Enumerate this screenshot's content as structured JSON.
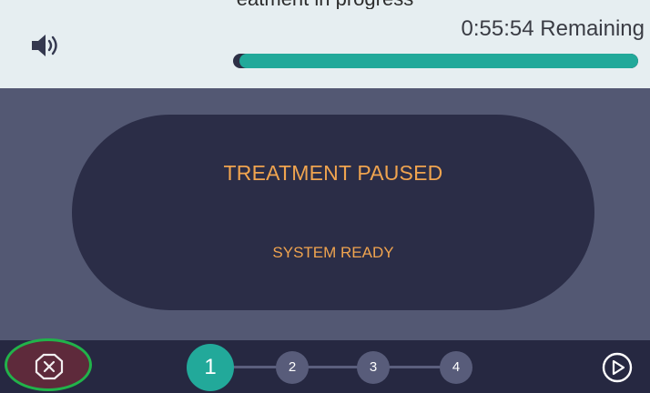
{
  "header": {
    "cut_off_title": "eatment in progress",
    "time_remaining": "0:55:54 Remaining",
    "progress_fraction": 0.985,
    "icons": {
      "volume": "speaker-volume-icon"
    }
  },
  "status": {
    "main": "TREATMENT PAUSED",
    "sub": "SYSTEM READY"
  },
  "footer": {
    "stop_icon": "stop-octagon-x-icon",
    "play_icon": "play-circle-icon",
    "steps": [
      "1",
      "2",
      "3",
      "4"
    ],
    "active_step": "1"
  },
  "colors": {
    "accent": "#22a99a",
    "status_text": "#f0a44f",
    "highlight_ring": "#21b34a",
    "stop_background": "#5e2a3b"
  }
}
